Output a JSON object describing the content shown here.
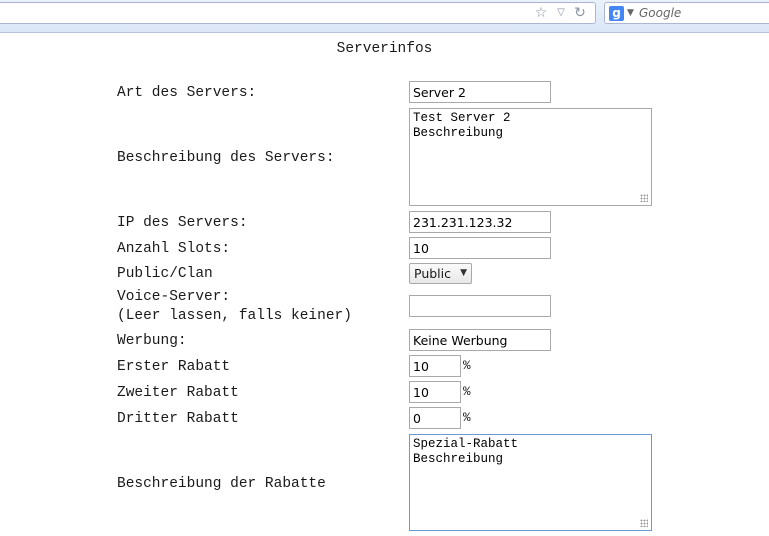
{
  "browser": {
    "search_placeholder": "Google",
    "search_engine_letter": "g"
  },
  "page": {
    "title": "Serverinfos",
    "fields": {
      "art": {
        "label": "Art des Servers:",
        "value": "Server 2"
      },
      "beschreibung": {
        "label": "Beschreibung des Servers:",
        "value": "Test Server 2\nBeschreibung"
      },
      "ip": {
        "label": "IP des Servers:",
        "value": "231.231.123.32"
      },
      "slots": {
        "label": "Anzahl Slots:",
        "value": "10"
      },
      "public_clan": {
        "label": "Public/Clan",
        "selected": "Public"
      },
      "voice": {
        "label_line1": "Voice-Server:",
        "label_line2": "(Leer lassen, falls keiner)",
        "value": ""
      },
      "werbung": {
        "label": "Werbung:",
        "value": "Keine Werbung"
      },
      "rabatt1": {
        "label": "Erster Rabatt",
        "value": "10",
        "unit": "%"
      },
      "rabatt2": {
        "label": "Zweiter Rabatt",
        "value": "10",
        "unit": "%"
      },
      "rabatt3": {
        "label": "Dritter Rabatt",
        "value": "0",
        "unit": "%"
      },
      "rabatt_beschreibung": {
        "label": "Beschreibung der Rabatte",
        "value": "Spezial-Rabatt\nBeschreibung"
      }
    }
  }
}
